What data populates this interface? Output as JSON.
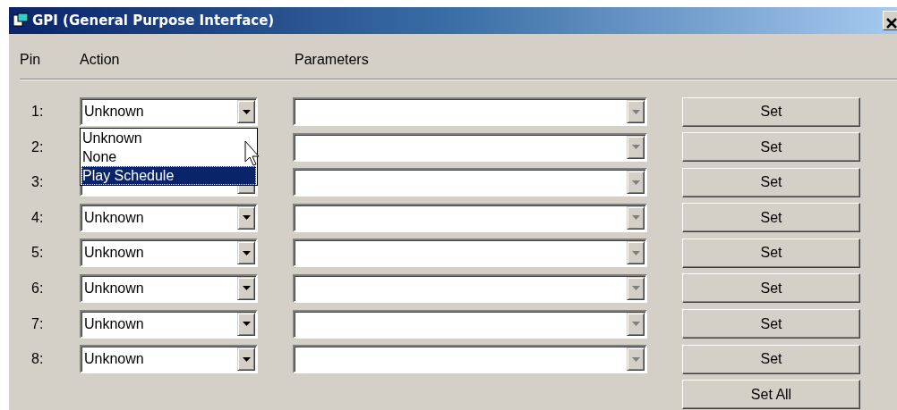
{
  "window": {
    "title": "GPI (General Purpose Interface)"
  },
  "columns": [
    "Pin",
    "Action",
    "Parameters"
  ],
  "rows": [
    {
      "pin": "1:",
      "action": "Unknown",
      "parameters_disabled": true,
      "button": "Set"
    },
    {
      "pin": "2:",
      "action_covered": true,
      "parameters_disabled": true,
      "button": "Set"
    },
    {
      "pin": "3:",
      "parameters_disabled": true,
      "button": "Set"
    },
    {
      "pin": "4:",
      "action": "Unknown",
      "parameters_disabled": true,
      "button": "Set"
    },
    {
      "pin": "5:",
      "action": "Unknown",
      "parameters_disabled": true,
      "button": "Set"
    },
    {
      "pin": "6:",
      "action": "Unknown",
      "parameters_disabled": true,
      "button": "Set"
    },
    {
      "pin": "7:",
      "action": "Unknown",
      "parameters_disabled": true,
      "button": "Set"
    },
    {
      "pin": "8:",
      "action": "Unknown",
      "parameters_disabled": true,
      "button": "Set"
    }
  ],
  "dropdown": {
    "items": [
      {
        "label": "Unknown",
        "selected": false
      },
      {
        "label": "None",
        "selected": false
      },
      {
        "label": "Play Schedule",
        "selected": true
      }
    ]
  },
  "set_all_button": "Set All"
}
